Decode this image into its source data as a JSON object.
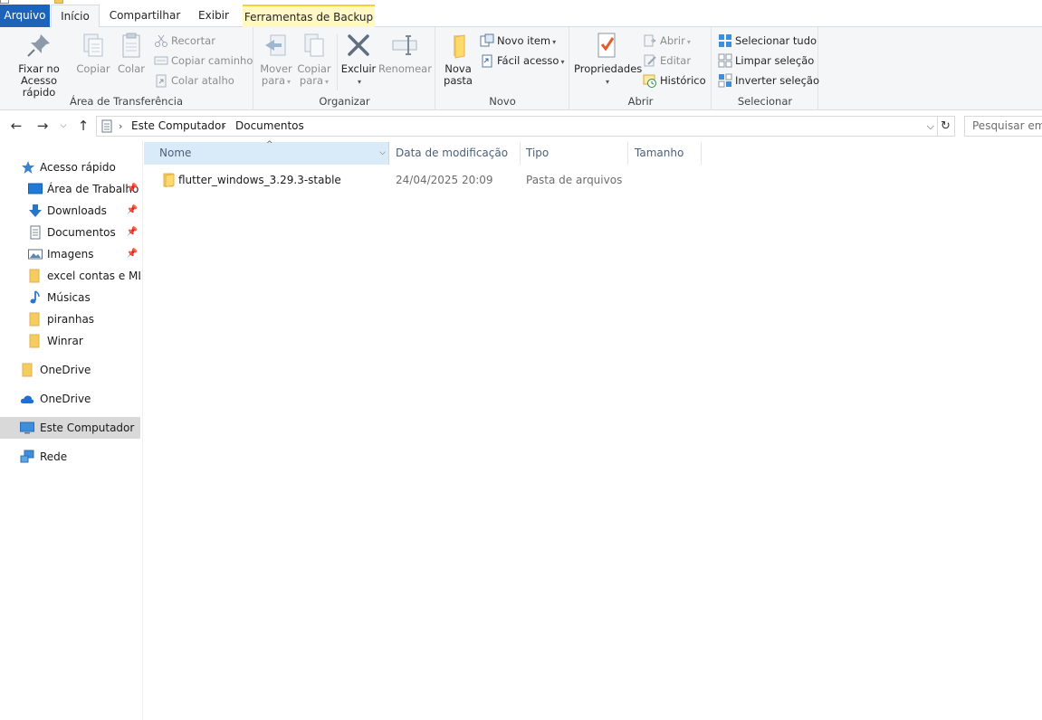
{
  "ribbon_tabs": {
    "file": "Arquivo",
    "home": "Início",
    "share": "Compartilhar",
    "view": "Exibir",
    "backup_tools": "Ferramentas de Backup"
  },
  "ribbon": {
    "clipboard": {
      "group_label": "Área de Transferência",
      "pin_label_1": "Fixar no",
      "pin_label_2": "Acesso rápido",
      "copy": "Copiar",
      "paste": "Colar",
      "cut": "Recortar",
      "copy_path": "Copiar caminho",
      "paste_shortcut": "Colar atalho"
    },
    "organize": {
      "group_label": "Organizar",
      "move_to_1": "Mover",
      "move_to_2": "para",
      "copy_to_1": "Copiar",
      "copy_to_2": "para",
      "delete": "Excluir",
      "rename": "Renomear"
    },
    "new": {
      "group_label": "Novo",
      "new_folder_1": "Nova",
      "new_folder_2": "pasta",
      "new_item": "Novo item",
      "easy_access": "Fácil acesso"
    },
    "open": {
      "group_label": "Abrir",
      "properties": "Propriedades",
      "open": "Abrir",
      "edit": "Editar",
      "history": "Histórico"
    },
    "select": {
      "group_label": "Selecionar",
      "select_all": "Selecionar tudo",
      "select_none": "Limpar seleção",
      "invert": "Inverter seleção"
    }
  },
  "address": {
    "crumbs": [
      "Este Computador",
      "Documentos"
    ],
    "search_placeholder": "Pesquisar em Documentos"
  },
  "nav_pane": {
    "quick_access": "Acesso rápido",
    "items": [
      {
        "label": "Área de Trabalho",
        "icon": "desktop-icon",
        "pinned": true
      },
      {
        "label": "Downloads",
        "icon": "download-icon",
        "pinned": true
      },
      {
        "label": "Documentos",
        "icon": "document-icon",
        "pinned": true
      },
      {
        "label": "Imagens",
        "icon": "pictures-icon",
        "pinned": true
      },
      {
        "label": "excel contas e ML a",
        "icon": "folder-icon",
        "pinned": false
      },
      {
        "label": "Músicas",
        "icon": "music-icon",
        "pinned": false
      },
      {
        "label": "piranhas",
        "icon": "folder-icon",
        "pinned": false
      },
      {
        "label": "Winrar",
        "icon": "folder-icon",
        "pinned": false
      }
    ],
    "onedrive_folder": "OneDrive",
    "onedrive_cloud": "OneDrive",
    "this_pc": "Este Computador",
    "network": "Rede"
  },
  "columns": {
    "name": "Nome",
    "modified": "Data de modificação",
    "type": "Tipo",
    "size": "Tamanho"
  },
  "files": [
    {
      "name": "flutter_windows_3.29.3-stable",
      "modified": "24/04/2025 20:09",
      "type": "Pasta de arquivos",
      "size": ""
    }
  ],
  "colors": {
    "accent": "#1c64b9",
    "folder": "#f3c95a",
    "selected_nav": "#d9d9d9",
    "sorted_column": "#d9ebf9"
  }
}
